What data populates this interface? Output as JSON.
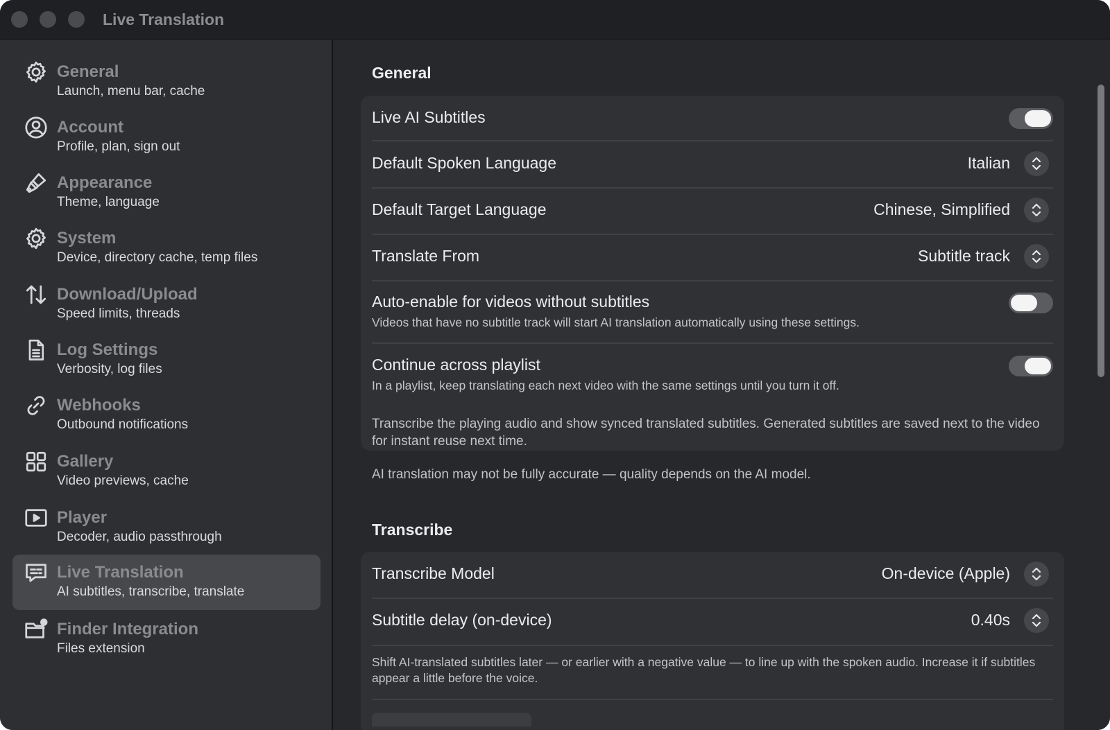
{
  "window": {
    "title": "Live Translation"
  },
  "sidebar": {
    "items": [
      {
        "title": "General",
        "subtitle": "Launch, menu bar, cache",
        "icon": "gear-icon"
      },
      {
        "title": "Account",
        "subtitle": "Profile, plan, sign out",
        "icon": "person-circle-icon"
      },
      {
        "title": "Appearance",
        "subtitle": "Theme, language",
        "icon": "paintbrush-icon"
      },
      {
        "title": "System",
        "subtitle": "Device, directory cache, temp files",
        "icon": "gear-icon"
      },
      {
        "title": "Download/Upload",
        "subtitle": "Speed limits, threads",
        "icon": "arrow-up-down-icon"
      },
      {
        "title": "Log Settings",
        "subtitle": "Verbosity, log files",
        "icon": "document-icon"
      },
      {
        "title": "Webhooks",
        "subtitle": "Outbound notifications",
        "icon": "link-icon"
      },
      {
        "title": "Gallery",
        "subtitle": "Video previews, cache",
        "icon": "grid-icon"
      },
      {
        "title": "Player",
        "subtitle": "Decoder, audio passthrough",
        "icon": "play-rectangle-icon"
      },
      {
        "title": "Live Translation",
        "subtitle": "AI subtitles, transcribe, translate",
        "icon": "captions-bubble-icon",
        "selected": true
      },
      {
        "title": "Finder Integration",
        "subtitle": "Files extension",
        "icon": "folder-gear-icon"
      }
    ]
  },
  "general": {
    "title": "General",
    "live_ai_subtitles": {
      "label": "Live AI Subtitles",
      "enabled": true
    },
    "spoken_language": {
      "label": "Default Spoken Language",
      "value": "Italian"
    },
    "target_language": {
      "label": "Default Target Language",
      "value": "Chinese, Simplified"
    },
    "translate_from": {
      "label": "Translate From",
      "value": "Subtitle track"
    },
    "auto_enable": {
      "label": "Auto-enable for videos without subtitles",
      "description": "Videos that have no subtitle track will start AI translation automatically using these settings.",
      "enabled": false
    },
    "continue_playlist": {
      "label": "Continue across playlist",
      "description": "In a playlist, keep translating each next video with the same settings until you turn it off.",
      "enabled": true
    },
    "note1": "Transcribe the playing audio and show synced translated subtitles. Generated subtitles are saved next to the video for instant reuse next time.",
    "note2": "AI translation may not be fully accurate — quality depends on the AI model."
  },
  "transcribe": {
    "title": "Transcribe",
    "model": {
      "label": "Transcribe Model",
      "value": "On-device (Apple)"
    },
    "delay": {
      "label": "Subtitle delay (on-device)",
      "value": "0.40s"
    },
    "delay_note": "Shift AI-translated subtitles later — or earlier with a negative value — to line up with the spoken audio. Increase it if subtitles appear a little before the voice."
  },
  "colors": {
    "window_bg": "#26282c",
    "sidebar_bg": "#2d2f33",
    "group_bg": "#2f3135",
    "selected_bg": "#46484c"
  }
}
